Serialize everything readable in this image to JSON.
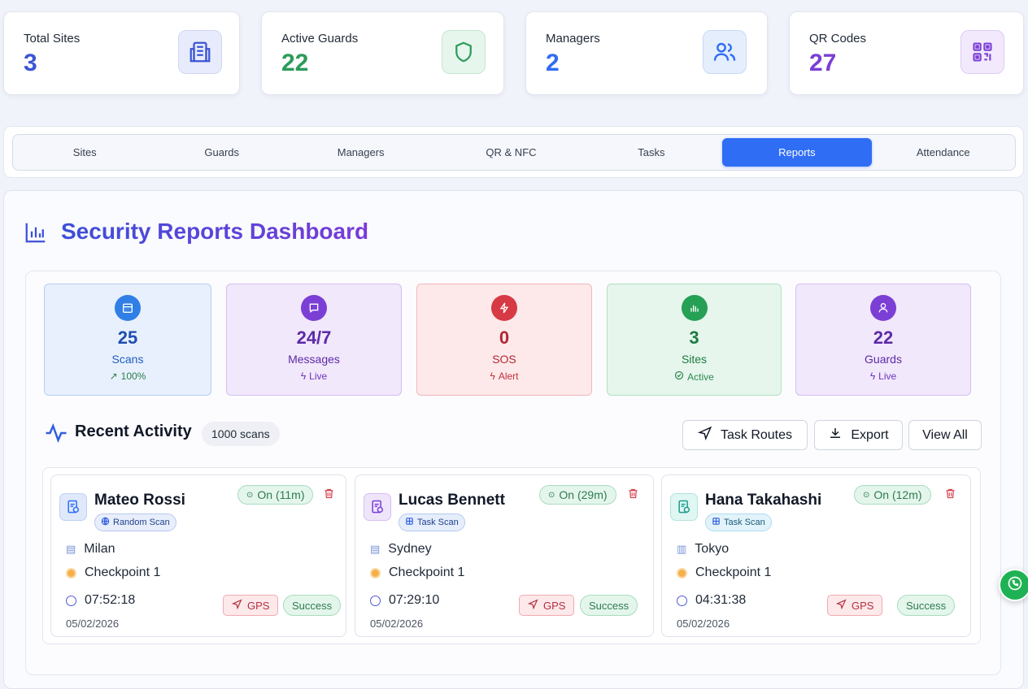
{
  "stats": [
    {
      "label": "Total Sites",
      "value": "3",
      "color": "#3b55d6",
      "icon": "building-icon"
    },
    {
      "label": "Active Guards",
      "value": "22",
      "color": "#2e9b5a",
      "icon": "shield-icon"
    },
    {
      "label": "Managers",
      "value": "2",
      "color": "#2f6df5",
      "icon": "users-icon"
    },
    {
      "label": "QR Codes",
      "value": "27",
      "color": "#7b3fd6",
      "icon": "qr-code-icon"
    }
  ],
  "tabs": [
    "Sites",
    "Guards",
    "Managers",
    "QR & NFC",
    "Tasks",
    "Reports",
    "Attendance"
  ],
  "active_tab": "Reports",
  "dashboard": {
    "title": "Security Reports Dashboard"
  },
  "metrics": [
    {
      "value": "25",
      "label": "Scans",
      "sub": "100%",
      "icon": "calendar-icon"
    },
    {
      "value": "24/7",
      "label": "Messages",
      "sub": "Live",
      "icon": "message-icon"
    },
    {
      "value": "0",
      "label": "SOS",
      "sub": "Alert",
      "icon": "lightning-icon"
    },
    {
      "value": "3",
      "label": "Sites",
      "sub": "Active",
      "icon": "chart-icon"
    },
    {
      "value": "22",
      "label": "Guards",
      "sub": "Live",
      "icon": "user-icon"
    }
  ],
  "activity": {
    "title": "Recent Activity",
    "count": "1000 scans",
    "buttons": {
      "routes": "Task Routes",
      "export": "Export",
      "view_all": "View All"
    },
    "items": [
      {
        "name": "Mateo Rossi",
        "type": "Random Scan",
        "status": "On (11m)",
        "site": "Milan",
        "checkpoint": "Checkpoint 1",
        "time": "07:52:18",
        "date": "05/02/2026",
        "gps": "GPS",
        "result": "Success"
      },
      {
        "name": "Lucas Bennett",
        "type": "Task Scan",
        "status": "On (29m)",
        "site": "Sydney",
        "checkpoint": "Checkpoint 1",
        "time": "07:29:10",
        "date": "05/02/2026",
        "gps": "GPS",
        "result": "Success"
      },
      {
        "name": "Hana Takahashi",
        "type": "Task Scan",
        "status": "On (12m)",
        "site": "Tokyo",
        "checkpoint": "Checkpoint 1",
        "time": "04:31:38",
        "date": "05/02/2026",
        "gps": "GPS",
        "result": "Success"
      }
    ]
  }
}
